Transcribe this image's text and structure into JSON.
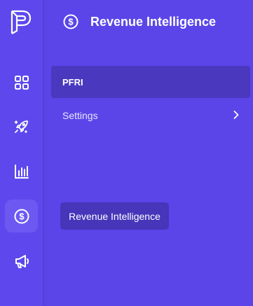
{
  "rail": {
    "items": [
      {
        "icon": "grid-icon"
      },
      {
        "icon": "rocket-sparkle-icon"
      },
      {
        "icon": "bar-chart-icon"
      },
      {
        "icon": "dollar-circle-icon",
        "active": true
      },
      {
        "icon": "megaphone-icon"
      }
    ]
  },
  "panel": {
    "title": "Revenue Intelligence",
    "title_icon": "dollar-circle-icon",
    "menu": [
      {
        "label": "PFRI",
        "active": true
      },
      {
        "label": "Settings",
        "has_submenu": true
      }
    ]
  },
  "tooltip": {
    "text": "Revenue Intelligence"
  },
  "colors": {
    "background": "#5b45e9",
    "active_item": "#4a38bf",
    "tooltip": "#4735ba",
    "rail_active": "#6d59f2",
    "text": "#ffffff"
  }
}
